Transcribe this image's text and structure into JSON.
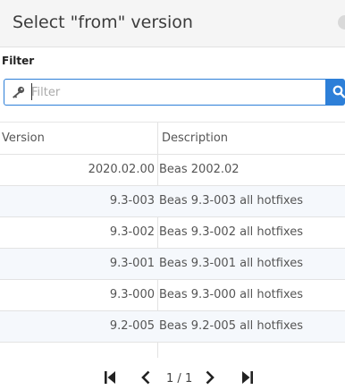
{
  "dialog": {
    "title": "Select \"from\" version"
  },
  "filter": {
    "label": "Filter",
    "placeholder": "Filter",
    "value": ""
  },
  "table": {
    "columns": [
      "Version",
      "Description"
    ],
    "rows": [
      {
        "version": "2020.02.00",
        "description": "Beas 2002.02"
      },
      {
        "version": "9.3-003",
        "description": "Beas 9.3-003 all hotfixes"
      },
      {
        "version": "9.3-002",
        "description": "Beas 9.3-002 all hotfixes"
      },
      {
        "version": "9.3-001",
        "description": "Beas 9.3-001 all hotfixes"
      },
      {
        "version": "9.3-000",
        "description": "Beas 9.3-000 all hotfixes"
      },
      {
        "version": "9.2-005",
        "description": "Beas 9.2-005 all hotfixes"
      }
    ]
  },
  "pagination": {
    "current": "1",
    "separator": "/",
    "total": "1"
  },
  "colors": {
    "accent": "#2d7fd8",
    "row_alt": "#f5f8fc",
    "header_bg": "#f5f5f5"
  }
}
